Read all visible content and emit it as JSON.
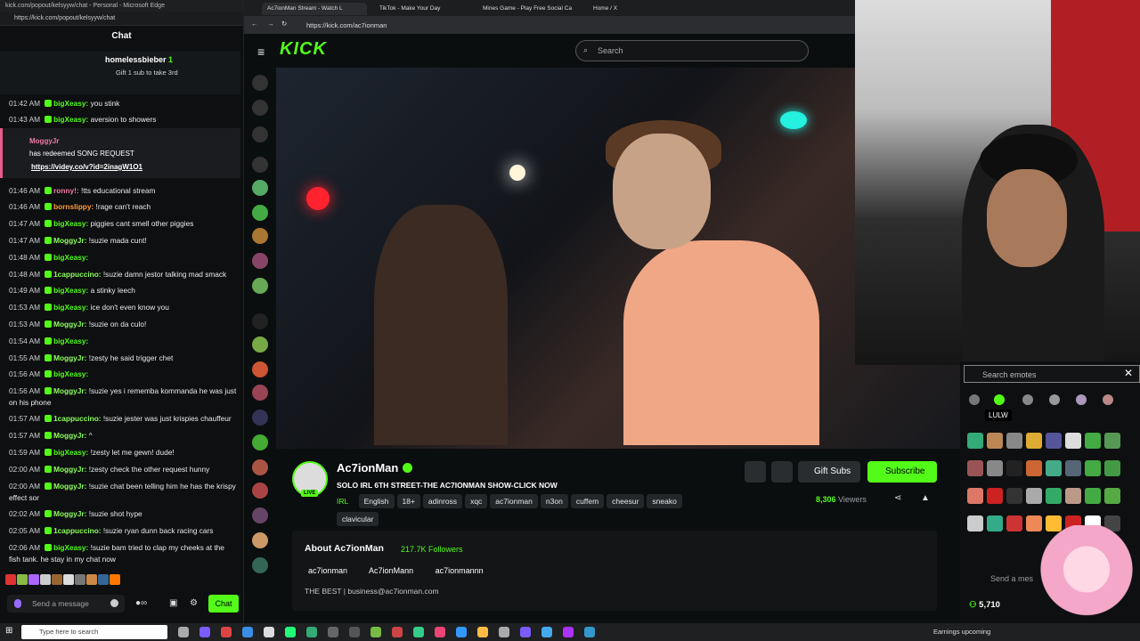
{
  "chat_window": {
    "title": "kick.com/popout/kelsyyw/chat - Personal - Microsoft Edge",
    "url": "https://kick.com/popout/kelsyyw/chat",
    "header": "Chat",
    "pinned_gift": {
      "user": "homelessbieber",
      "count": "1",
      "text": "Gift 1 sub to take 3rd"
    },
    "redeem": {
      "user": "MoggyJr",
      "text": "has redeemed SONG REQUEST",
      "link": "https://videy.co/v?id=2inagW1O1"
    },
    "messages": [
      {
        "time": "01:42 AM",
        "user": "bigXeasy:",
        "text": "you stink",
        "color": "green"
      },
      {
        "time": "01:43 AM",
        "user": "bigXeasy:",
        "text": "aversion to showers",
        "color": "green"
      },
      {
        "time": "01:46 AM",
        "user": "ronny!:",
        "text": "!tts educational stream",
        "color": "pink"
      },
      {
        "time": "01:46 AM",
        "user": "bornslippy:",
        "text": "!rage can't reach",
        "color": "orange"
      },
      {
        "time": "01:47 AM",
        "user": "bigXeasy:",
        "text": "piggies cant smell other piggies",
        "color": "green"
      },
      {
        "time": "01:47 AM",
        "user": "MoggyJr:",
        "text": "!suzie mada cunt!",
        "color": "lime"
      },
      {
        "time": "01:48 AM",
        "user": "bigXeasy:",
        "text": "",
        "color": "green"
      },
      {
        "time": "01:48 AM",
        "user": "1cappuccino:",
        "text": "!suzie damn jestor talking mad smack",
        "color": "lime"
      },
      {
        "time": "01:49 AM",
        "user": "bigXeasy:",
        "text": "a stinky leech",
        "color": "green"
      },
      {
        "time": "01:53 AM",
        "user": "bigXeasy:",
        "text": "ice don't even know you",
        "color": "green"
      },
      {
        "time": "01:53 AM",
        "user": "MoggyJr:",
        "text": "!suzie on da culo!",
        "color": "lime"
      },
      {
        "time": "01:54 AM",
        "user": "bigXeasy:",
        "text": "",
        "color": "green"
      },
      {
        "time": "01:55 AM",
        "user": "MoggyJr:",
        "text": "!zesty he said trigger chet",
        "color": "lime"
      },
      {
        "time": "01:56 AM",
        "user": "bigXeasy:",
        "text": "",
        "color": "green"
      },
      {
        "time": "01:56 AM",
        "user": "MoggyJr:",
        "text": "!suzie yes i rememba kommanda he was just on his phone",
        "color": "lime"
      },
      {
        "time": "01:57 AM",
        "user": "1cappuccino:",
        "text": "!suzie jester was just krispies chauffeur",
        "color": "lime"
      },
      {
        "time": "01:57 AM",
        "user": "MoggyJr:",
        "text": "^",
        "color": "lime"
      },
      {
        "time": "01:59 AM",
        "user": "bigXeasy:",
        "text": "!zesty let me gewn! dude!",
        "color": "green"
      },
      {
        "time": "02:00 AM",
        "user": "MoggyJr:",
        "text": "!zesty check the other request hunny",
        "color": "lime"
      },
      {
        "time": "02:00 AM",
        "user": "MoggyJr:",
        "text": "!suzie chat been telling him he has the krispy effect sor",
        "color": "lime"
      },
      {
        "time": "02:02 AM",
        "user": "MoggyJr:",
        "text": "!suzie shot hype",
        "color": "lime"
      },
      {
        "time": "02:05 AM",
        "user": "1cappuccino:",
        "text": "!suzie ryan dunn back racing cars",
        "color": "lime"
      },
      {
        "time": "02:06 AM",
        "user": "bigXeasy:",
        "text": "!suzie bam tried to clap my cheeks at the fish tank. he stay in my chat now",
        "color": "green"
      }
    ],
    "send_placeholder": "Send a message",
    "chat_button": "Chat"
  },
  "browser": {
    "tabs": [
      "Ac7ionMan Stream - Watch L",
      "TikTok - Make Your Day",
      "Mines Game - Play Free Social Ca",
      "Home / X"
    ],
    "url": "https://kick.com/ac7ionman",
    "logo": "KICK",
    "search_placeholder": "Search"
  },
  "stream": {
    "name": "Ac7ionMan",
    "live": "LIVE",
    "title": "SOLO IRL 6TH STREET-THE AC7IONMAN SHOW-CLICK NOW",
    "category": "IRL",
    "tags": [
      "English",
      "18+",
      "adinross",
      "xqc",
      "ac7ionman",
      "n3on",
      "cuffem",
      "cheesur",
      "sneako",
      "clavicular"
    ],
    "gift_label": "Gift Subs",
    "subscribe_label": "Subscribe",
    "viewers": "8,306",
    "viewers_label": "Viewers"
  },
  "about": {
    "title": "About Ac7ionMan",
    "followers": "217.7K Followers",
    "instagram": "ac7ionman",
    "x": "Ac7ionMann",
    "discord": "ac7ionmannn",
    "bio": "THE BEST | business@ac7ionman.com"
  },
  "emote_panel": {
    "search_placeholder": "Search emotes",
    "tooltip": "LULW",
    "send_placeholder": "Send a mes",
    "viewers": "5,710"
  },
  "taskbar": {
    "search_placeholder": "Type here to search",
    "earnings": "Earnings upcoming"
  },
  "colors": {
    "kick_green": "#53fc18",
    "dark_bg": "#0b0e0f"
  }
}
